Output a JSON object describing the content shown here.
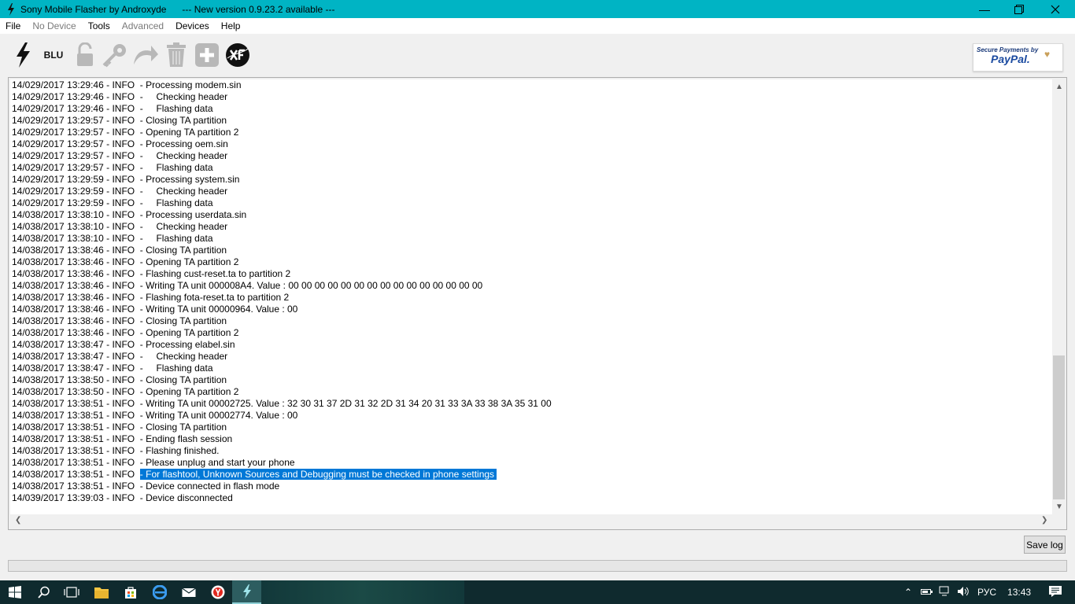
{
  "window": {
    "title": "Sony Mobile Flasher by Androxyde      --- New version 0.9.23.2 available ---"
  },
  "menu": [
    {
      "label": "File",
      "enabled": true
    },
    {
      "label": "No Device",
      "enabled": false
    },
    {
      "label": "Tools",
      "enabled": true
    },
    {
      "label": "Advanced",
      "enabled": false
    },
    {
      "label": "Devices",
      "enabled": true
    },
    {
      "label": "Help",
      "enabled": true
    }
  ],
  "toolbar": {
    "blu_label": "BLU",
    "paypal_line1": "Secure Payments by",
    "paypal_line2": "PayPal."
  },
  "log": [
    {
      "ts": "14/029/2017 13:29:46 - INFO  - ",
      "msg": "Processing modem.sin"
    },
    {
      "ts": "14/029/2017 13:29:46 - INFO  - ",
      "msg": "    Checking header"
    },
    {
      "ts": "14/029/2017 13:29:46 - INFO  - ",
      "msg": "    Flashing data"
    },
    {
      "ts": "14/029/2017 13:29:57 - INFO  - ",
      "msg": "Closing TA partition"
    },
    {
      "ts": "14/029/2017 13:29:57 - INFO  - ",
      "msg": "Opening TA partition 2"
    },
    {
      "ts": "14/029/2017 13:29:57 - INFO  - ",
      "msg": "Processing oem.sin"
    },
    {
      "ts": "14/029/2017 13:29:57 - INFO  - ",
      "msg": "    Checking header"
    },
    {
      "ts": "14/029/2017 13:29:57 - INFO  - ",
      "msg": "    Flashing data"
    },
    {
      "ts": "14/029/2017 13:29:59 - INFO  - ",
      "msg": "Processing system.sin"
    },
    {
      "ts": "14/029/2017 13:29:59 - INFO  - ",
      "msg": "    Checking header"
    },
    {
      "ts": "14/029/2017 13:29:59 - INFO  - ",
      "msg": "    Flashing data"
    },
    {
      "ts": "14/038/2017 13:38:10 - INFO  - ",
      "msg": "Processing userdata.sin"
    },
    {
      "ts": "14/038/2017 13:38:10 - INFO  - ",
      "msg": "    Checking header"
    },
    {
      "ts": "14/038/2017 13:38:10 - INFO  - ",
      "msg": "    Flashing data"
    },
    {
      "ts": "14/038/2017 13:38:46 - INFO  - ",
      "msg": "Closing TA partition"
    },
    {
      "ts": "14/038/2017 13:38:46 - INFO  - ",
      "msg": "Opening TA partition 2"
    },
    {
      "ts": "14/038/2017 13:38:46 - INFO  - ",
      "msg": "Flashing cust-reset.ta to partition 2"
    },
    {
      "ts": "14/038/2017 13:38:46 - INFO  - ",
      "msg": "Writing TA unit 000008A4. Value : 00 00 00 00 00 00 00 00 00 00 00 00 00 00 00"
    },
    {
      "ts": "14/038/2017 13:38:46 - INFO  - ",
      "msg": "Flashing fota-reset.ta to partition 2"
    },
    {
      "ts": "14/038/2017 13:38:46 - INFO  - ",
      "msg": "Writing TA unit 00000964. Value : 00"
    },
    {
      "ts": "14/038/2017 13:38:46 - INFO  - ",
      "msg": "Closing TA partition"
    },
    {
      "ts": "14/038/2017 13:38:46 - INFO  - ",
      "msg": "Opening TA partition 2"
    },
    {
      "ts": "14/038/2017 13:38:47 - INFO  - ",
      "msg": "Processing elabel.sin"
    },
    {
      "ts": "14/038/2017 13:38:47 - INFO  - ",
      "msg": "    Checking header"
    },
    {
      "ts": "14/038/2017 13:38:47 - INFO  - ",
      "msg": "    Flashing data"
    },
    {
      "ts": "14/038/2017 13:38:50 - INFO  - ",
      "msg": "Closing TA partition"
    },
    {
      "ts": "14/038/2017 13:38:50 - INFO  - ",
      "msg": "Opening TA partition 2"
    },
    {
      "ts": "14/038/2017 13:38:51 - INFO  - ",
      "msg": "Writing TA unit 00002725. Value : 32 30 31 37 2D 31 32 2D 31 34 20 31 33 3A 33 38 3A 35 31 00"
    },
    {
      "ts": "14/038/2017 13:38:51 - INFO  - ",
      "msg": "Writing TA unit 00002774. Value : 00"
    },
    {
      "ts": "14/038/2017 13:38:51 - INFO  - ",
      "msg": "Closing TA partition"
    },
    {
      "ts": "14/038/2017 13:38:51 - INFO  - ",
      "msg": "Ending flash session"
    },
    {
      "ts": "14/038/2017 13:38:51 - INFO  - ",
      "msg": "Flashing finished."
    },
    {
      "ts": "14/038/2017 13:38:51 - INFO  - ",
      "msg": "Please unplug and start your phone"
    },
    {
      "ts": "14/038/2017 13:38:51 - INFO  ",
      "msg": "- For flashtool, Unknown Sources and Debugging must be checked in phone settings ",
      "selected": true
    },
    {
      "ts": "14/038/2017 13:38:51 - INFO  - ",
      "msg": "Device connected in flash mode"
    },
    {
      "ts": "14/039/2017 13:39:03 - INFO  - ",
      "msg": "Device disconnected"
    }
  ],
  "buttons": {
    "save_log": "Save log"
  },
  "taskbar": {
    "language": "РУС",
    "clock": "13:43"
  },
  "colors": {
    "titlebar": "#00b4c4",
    "selection": "#0078d7",
    "taskbar": "#0f2a2e"
  }
}
